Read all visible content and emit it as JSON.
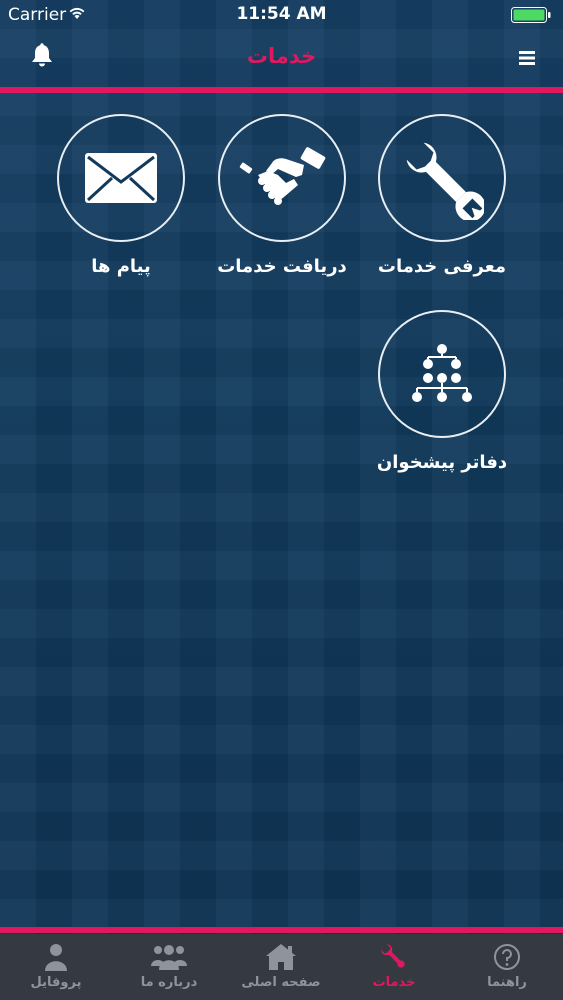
{
  "status_bar": {
    "carrier": "Carrier",
    "time": "11:54 AM"
  },
  "nav": {
    "title": "خدمات"
  },
  "tiles": [
    {
      "label": "معرفی خدمات",
      "icon": "wrench-icon"
    },
    {
      "label": "دریافت خدمات",
      "icon": "handshake-icon"
    },
    {
      "label": "پیام ها",
      "icon": "envelope-icon"
    },
    {
      "label": "دفاتر پیشخوان",
      "icon": "sitemap-icon"
    }
  ],
  "tabbar": [
    {
      "label": "راهنما",
      "icon": "help-icon"
    },
    {
      "label": "خدمات",
      "icon": "wrench-icon",
      "active": true
    },
    {
      "label": "صفحه اصلی",
      "icon": "home-icon"
    },
    {
      "label": "درباره ما",
      "icon": "users-icon"
    },
    {
      "label": "پروفایل",
      "icon": "user-icon"
    }
  ],
  "colors": {
    "accent": "#e0185f",
    "background": "#123a5c",
    "tabbar": "#353a42",
    "tab_inactive": "#8e949b"
  }
}
